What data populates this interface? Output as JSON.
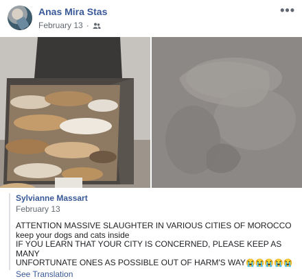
{
  "post": {
    "author": "Anas Mira Stas",
    "date": "February 13",
    "audience_icon": "friends-icon",
    "more_label": "•••"
  },
  "photos": {
    "left_icon": "photo-dumpster",
    "right_icon": "photo-faded-dog"
  },
  "shared": {
    "author": "Sylvianne Massart",
    "date": "February 13",
    "lines": [
      "ATTENTION MASSIVE SLAUGHTER IN VARIOUS CITIES OF MOROCCO",
      "keep your dogs and cats inside",
      "IF YOU LEARN THAT YOUR CITY IS CONCERNED, PLEASE KEEP AS MANY",
      "UNFORTUNATE ONES AS POSSIBLE OUT OF HARM'S WAY"
    ],
    "emojis": "😭😭😭😭😭",
    "see_translation": "See Translation"
  },
  "colors": {
    "link": "#385898",
    "meta": "#616770"
  }
}
